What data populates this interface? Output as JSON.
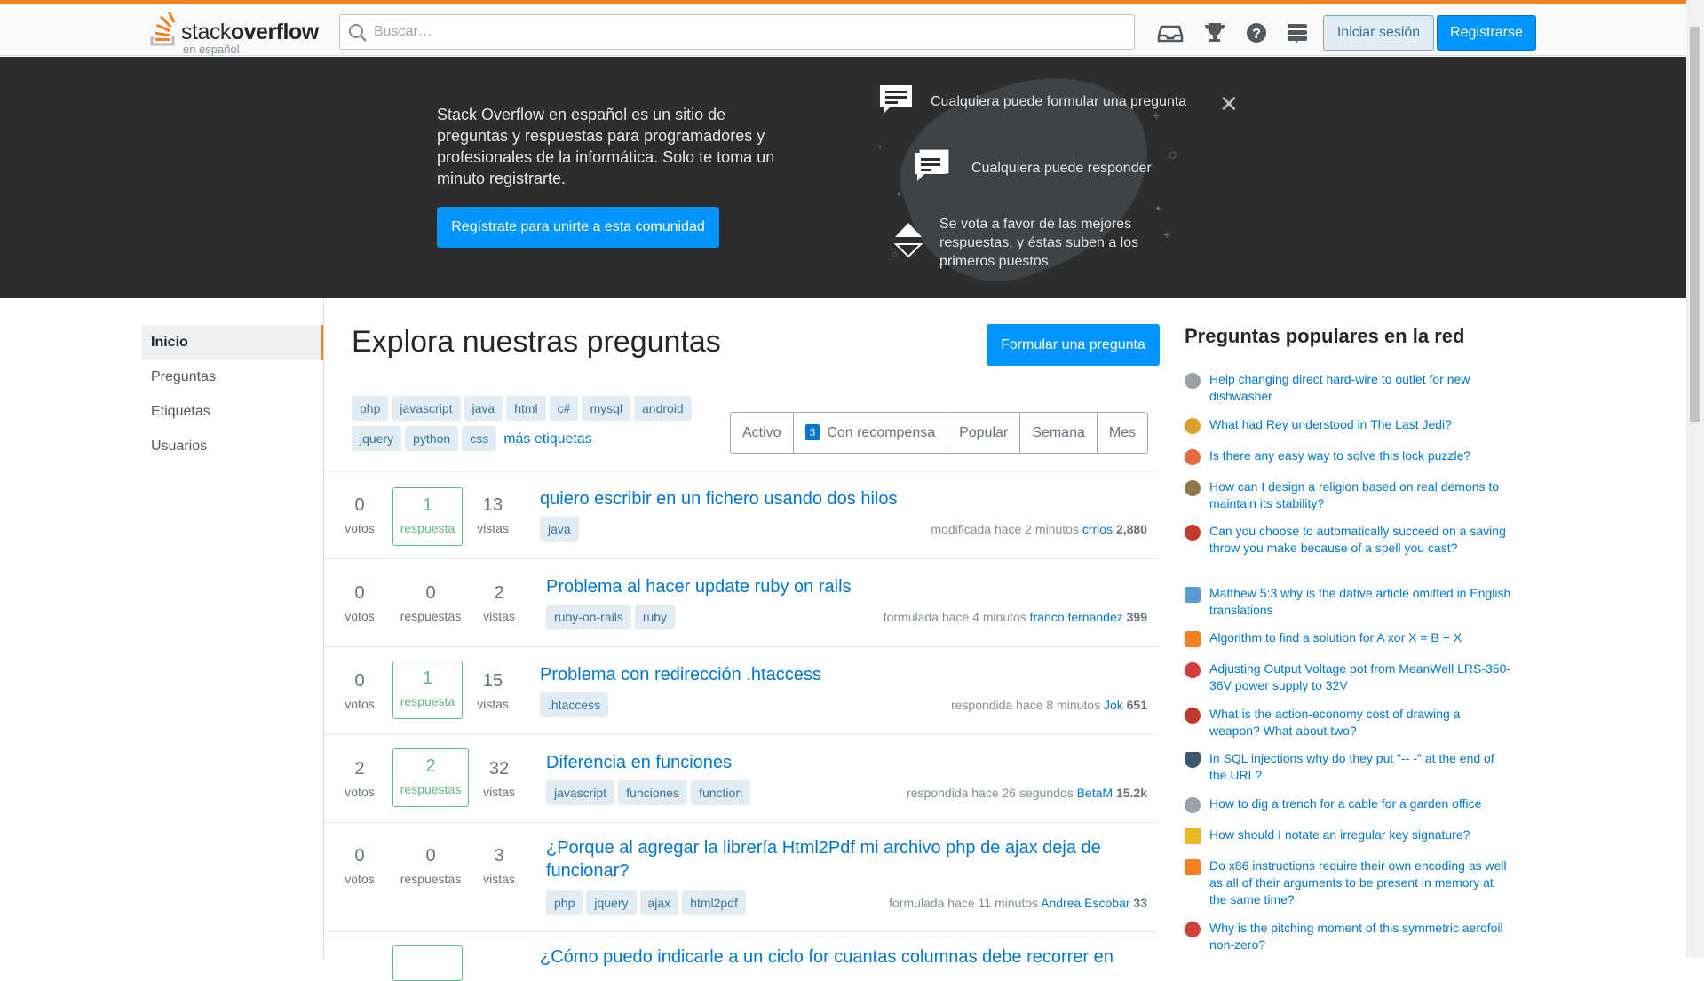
{
  "topbar": {
    "logo_text_a": "stack",
    "logo_text_b": "overflow",
    "logo_sub": "en español",
    "search_placeholder": "Buscar…",
    "login_label": "Iniciar sesión",
    "register_label": "Registrarse",
    "icons": [
      "inbox-icon",
      "achievements-icon",
      "help-icon",
      "site-switcher-icon"
    ]
  },
  "hero": {
    "text": "Stack Overflow en español es un sitio de preguntas y respuestas para programadores y profesionales de la informática. Solo te toma un minuto registrarte.",
    "cta": "Regístrate para unirte a esta comunidad",
    "feature1": "Cualquiera puede formular una pregunta",
    "feature2": "Cualquiera puede responder",
    "feature3": "Se vota a favor de las mejores respuestas, y éstas suben a los primeros puestos"
  },
  "nav": {
    "items": [
      "Inicio",
      "Preguntas",
      "Etiquetas",
      "Usuarios"
    ]
  },
  "main": {
    "title": "Explora nuestras preguntas",
    "ask_label": "Formular una pregunta",
    "popular_tags": [
      "php",
      "javascript",
      "java",
      "html",
      "c#",
      "mysql",
      "android",
      "jquery",
      "python",
      "css"
    ],
    "more_tags": "más etiquetas",
    "tabs": [
      "Activo",
      "Con recompensa",
      "Popular",
      "Semana",
      "Mes"
    ],
    "bounty_count": "3"
  },
  "questions": [
    {
      "votes": "0",
      "votes_label": "votos",
      "answers": "1",
      "answers_label": "respuesta",
      "answered": true,
      "views": "13",
      "views_label": "vistas",
      "title": "quiero escribir en un fichero usando dos hilos",
      "tags": [
        "java"
      ],
      "action": "modificada hace 2 minutos",
      "user": "crrlos",
      "rep": "2,880"
    },
    {
      "votes": "0",
      "votes_label": "votos",
      "answers": "0",
      "answers_label": "respuestas",
      "answered": false,
      "views": "2",
      "views_label": "vistas",
      "title": "Problema al hacer update ruby on rails",
      "tags": [
        "ruby-on-rails",
        "ruby"
      ],
      "action": "formulada hace 4 minutos",
      "user": "franco fernandez",
      "rep": "399"
    },
    {
      "votes": "0",
      "votes_label": "votos",
      "answers": "1",
      "answers_label": "respuesta",
      "answered": true,
      "views": "15",
      "views_label": "vistas",
      "title": "Problema con redirección .htaccess",
      "tags": [
        ".htaccess"
      ],
      "action": "respondida hace 8 minutos",
      "user": "Jok",
      "rep": "651"
    },
    {
      "votes": "2",
      "votes_label": "votos",
      "answers": "2",
      "answers_label": "respuestas",
      "answered": true,
      "views": "32",
      "views_label": "vistas",
      "title": "Diferencia en funciones",
      "tags": [
        "javascript",
        "funciones",
        "function"
      ],
      "action": "respondida hace 26 segundos",
      "user": "BetaM",
      "rep": "15.2k"
    },
    {
      "votes": "0",
      "votes_label": "votos",
      "answers": "0",
      "answers_label": "respuestas",
      "answered": false,
      "views": "3",
      "views_label": "vistas",
      "title": "¿Porque al agregar la librería Html2Pdf mi archivo php de ajax deja de funcionar?",
      "tags": [
        "php",
        "jquery",
        "ajax",
        "html2pdf"
      ],
      "action": "formulada hace 11 minutos",
      "user": "Andrea Escobar",
      "rep": "33"
    },
    {
      "title": "¿Cómo puedo indicarle a un ciclo for cuantas columnas debe recorrer en"
    }
  ],
  "sidebar": {
    "title": "Preguntas populares en la red",
    "items": [
      {
        "text": "Help changing direct hard-wire to outlet for new dishwasher",
        "color": "#9aa0a6"
      },
      {
        "text": "What had Rey understood in The Last Jedi?",
        "color": "#d9a12a"
      },
      {
        "text": "Is there any easy way to solve this lock puzzle?",
        "color": "#e56a3f"
      },
      {
        "text": "How can I design a religion based on real demons to maintain its stability?",
        "color": "#8c7a4a"
      },
      {
        "text": "Can you choose to automatically succeed on a saving throw you make because of a spell you cast?",
        "color": "#c0392b"
      },
      {
        "text": "Matthew 5:3 why is the dative article omitted in English translations",
        "color": "#5b9bd5"
      },
      {
        "text": "Algorithm to find a solution for A xor X = B + X",
        "color": "#f48024"
      },
      {
        "text": "Adjusting Output Voltage pot from MeanWell LRS-350-36V power supply to 32V",
        "color": "#d33f3f"
      },
      {
        "text": "What is the action-economy cost of drawing a weapon? What about two?",
        "color": "#c0392b"
      },
      {
        "text": "In SQL injections why do they put \"-- -\" at the end of the URL?",
        "color": "#3d5a6c"
      },
      {
        "text": "How to dig a trench for a cable for a garden office",
        "color": "#9aa0a6"
      },
      {
        "text": "How should I notate an irregular key signature?",
        "color": "#e8b923"
      },
      {
        "text": "Do x86 instructions require their own encoding as well as all of their arguments to be present in memory at the same time?",
        "color": "#f48024"
      },
      {
        "text": "Why is the pitching moment of this symmetric aerofoil non-zero?",
        "color": "#d33f3f"
      }
    ]
  }
}
